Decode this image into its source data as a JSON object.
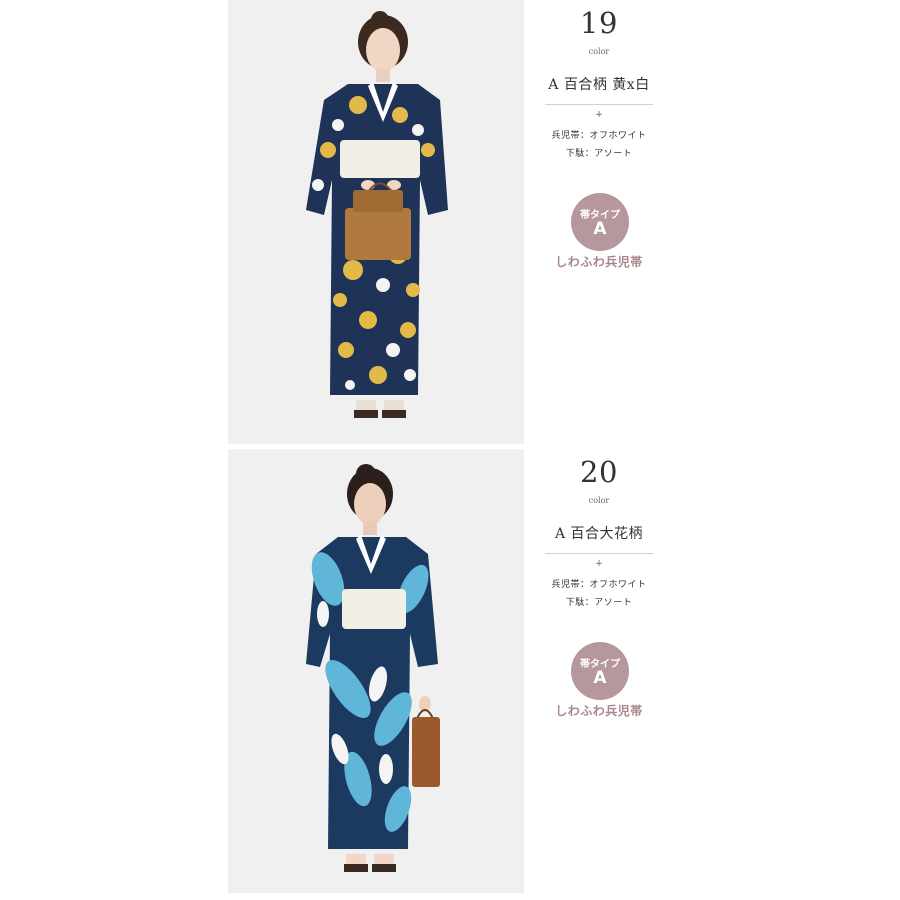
{
  "items": [
    {
      "number": "19",
      "color_label": "color",
      "pattern": "A 百合柄 黄x白",
      "plus": "+",
      "obi": "兵児帯：オフホワイト",
      "geta": "下駄：アソート",
      "badge_type": "帯タイプ",
      "badge_letter": "A",
      "obi_name": "しわふわ兵児帯",
      "colors": {
        "kimono": "#1f3358",
        "flower": "#e3b94a",
        "flower2": "#f4f4f2",
        "obi": "#f1efe6",
        "bag": "#b07a3f"
      }
    },
    {
      "number": "20",
      "color_label": "color",
      "pattern": "A 百合大花柄",
      "plus": "+",
      "obi": "兵児帯：オフホワイト",
      "geta": "下駄：アソート",
      "badge_type": "帯タイプ",
      "badge_letter": "A",
      "obi_name": "しわふわ兵児帯",
      "colors": {
        "kimono": "#1c3a60",
        "flower": "#5fb6d9",
        "flower2": "#f4f4f2",
        "obi": "#f1efe6",
        "bag": "#9b5a2e"
      }
    }
  ],
  "badge_color": "#b6989c",
  "obi_name_color": "#a8868b"
}
